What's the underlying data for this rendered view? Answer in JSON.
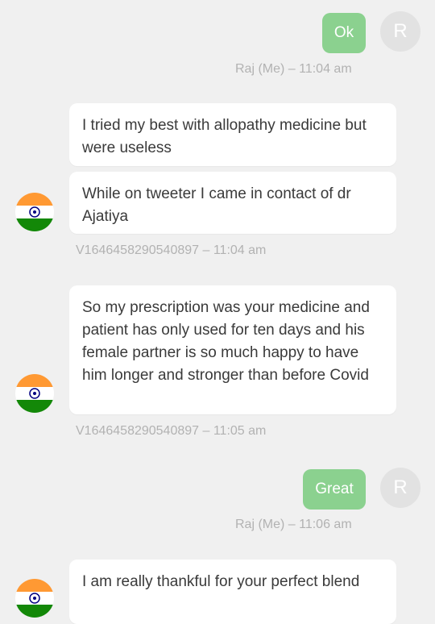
{
  "messages": [
    {
      "text": "Ok",
      "avatar": "R",
      "meta": "Raj (Me) – 11:04 am"
    },
    {
      "lines": [
        "I tried my best with allopathy medicine but were useless"
      ]
    },
    {
      "lines": [
        "While on tweeter I came in contact of dr Ajatiya"
      ],
      "meta": "V1646458290540897 – 11:04 am"
    },
    {
      "lines": [
        "So my prescription was your medicine and patient has only used for ten days and his female partner is so much happy to have him longer and stronger than before Covid"
      ],
      "meta": "V1646458290540897 – 11:05 am"
    },
    {
      "text": "Great",
      "avatar": "R",
      "meta": "Raj (Me) – 11:06 am"
    },
    {
      "lines": [
        "I am really thankful for your perfect blend"
      ]
    }
  ],
  "colors": {
    "background": "#f0f0f0",
    "outgoing_bubble": "#8bd18f",
    "incoming_bubble": "#ffffff",
    "meta_text": "#b2b2b2"
  },
  "icons": {
    "incoming_avatar": "india-flag-icon"
  }
}
